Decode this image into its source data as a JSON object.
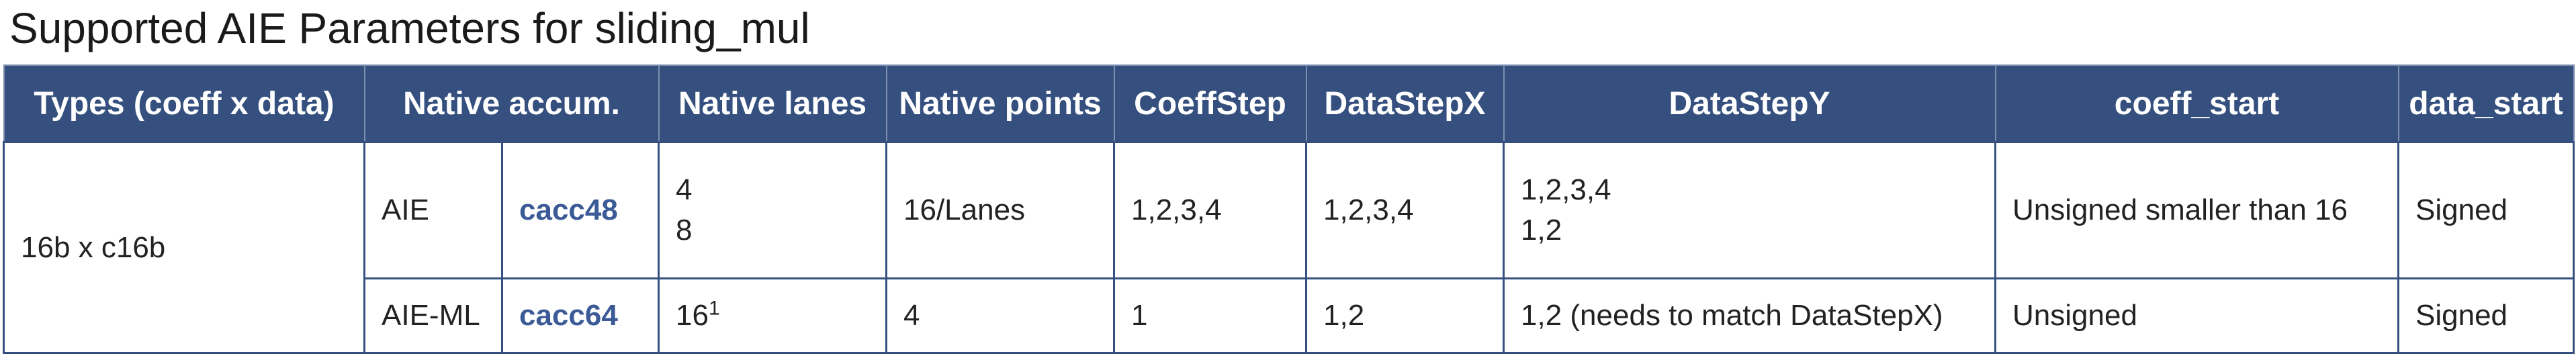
{
  "title": "Supported AIE Parameters for sliding_mul",
  "headers": {
    "types": "Types (coeff x data)",
    "native_accum": "Native accum.",
    "native_lanes": "Native lanes",
    "native_points": "Native points",
    "coeff_step": "CoeffStep",
    "data_step_x": "DataStepX",
    "data_step_y": "DataStepY",
    "coeff_start": "coeff_start",
    "data_start": "data_start"
  },
  "rows": [
    {
      "arch": "AIE",
      "accum": "cacc48",
      "lanes": [
        "4",
        "8"
      ],
      "points": "16/Lanes",
      "coeff_step": "1,2,3,4",
      "data_step_x": "1,2,3,4",
      "data_step_y": [
        "1,2,3,4",
        "1,2"
      ],
      "coeff_start": "Unsigned smaller than 16",
      "data_start": "Signed"
    },
    {
      "arch": "AIE-ML",
      "accum": "cacc64",
      "lanes": "16",
      "lanes_footnote": "1",
      "points": "4",
      "coeff_step": "1",
      "data_step_x": "1,2",
      "data_step_y": "1,2 (needs to match DataStepX)",
      "coeff_start": "Unsigned",
      "data_start": "Signed"
    }
  ],
  "group": {
    "types": "16b x c16b"
  },
  "colors": {
    "header_bg": "#35507f",
    "header_text": "#ffffff",
    "link": "#3b5a96",
    "border": "#35507f"
  }
}
